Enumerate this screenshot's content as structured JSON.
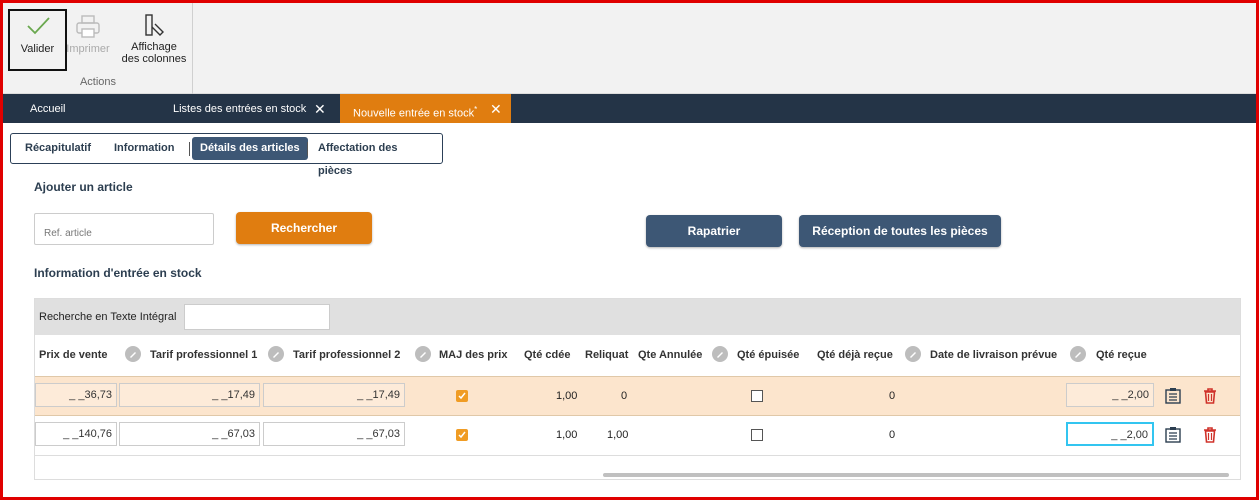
{
  "ribbon": {
    "valider_label": "Valider",
    "imprimer_label": "Imprimer",
    "affichage_label_line1": "Affichage",
    "affichage_label_line2": "des colonnes",
    "group_label": "Actions"
  },
  "tabs": [
    {
      "label": "Accueil"
    },
    {
      "label": "Listes des entrées en stock",
      "close": "✕"
    },
    {
      "label": "Nouvelle entrée en stock",
      "modified_mark": "*",
      "close": "✕"
    }
  ],
  "section_tabs": [
    "Récapitulatif",
    "Information",
    "Détails des articles",
    "Affectation des pièces"
  ],
  "add_article": {
    "title": "Ajouter un article",
    "ref_placeholder": "Ref. article",
    "search_button": "Rechercher",
    "repatrier_button": "Rapatrier",
    "reception_button": "Réception de toutes les pièces"
  },
  "stock_info": {
    "title": "Information d'entrée en stock",
    "fulltext_label": "Recherche en Texte Intégral"
  },
  "grid": {
    "headers": {
      "prix_vente": "Prix de vente",
      "tarif1": "Tarif professionnel 1",
      "tarif2": "Tarif professionnel 2",
      "maj": "MAJ des prix",
      "qte_cdee": "Qté cdée",
      "reliquat": "Reliquat",
      "qte_annulee": "Qte Annulée",
      "qte_epuisee": "Qté épuisée",
      "qte_deja": "Qté déjà reçue",
      "date_livraison": "Date de livraison prévue",
      "qte_recue": "Qté reçue"
    },
    "rows": [
      {
        "prix_vente": "_ _36,73",
        "tarif1": "_ _17,49",
        "tarif2": "_ _17,49",
        "maj": true,
        "qte_cdee": "1,00",
        "reliquat": "0",
        "qte_epuisee": false,
        "qte_deja": "0",
        "qte_recue": "_ _2,00"
      },
      {
        "prix_vente": "_ _140,76",
        "tarif1": "_ _67,03",
        "tarif2": "_ _67,03",
        "maj": true,
        "qte_cdee": "1,00",
        "reliquat": "1,00",
        "qte_epuisee": false,
        "qte_deja": "0",
        "qte_recue": "_ _2,00"
      }
    ]
  },
  "colors": {
    "accent_orange": "#e07d10",
    "navy": "#243447",
    "button_navy": "#3d5775",
    "row_highlight": "#fce5cd",
    "delete_red": "#d0332b"
  }
}
